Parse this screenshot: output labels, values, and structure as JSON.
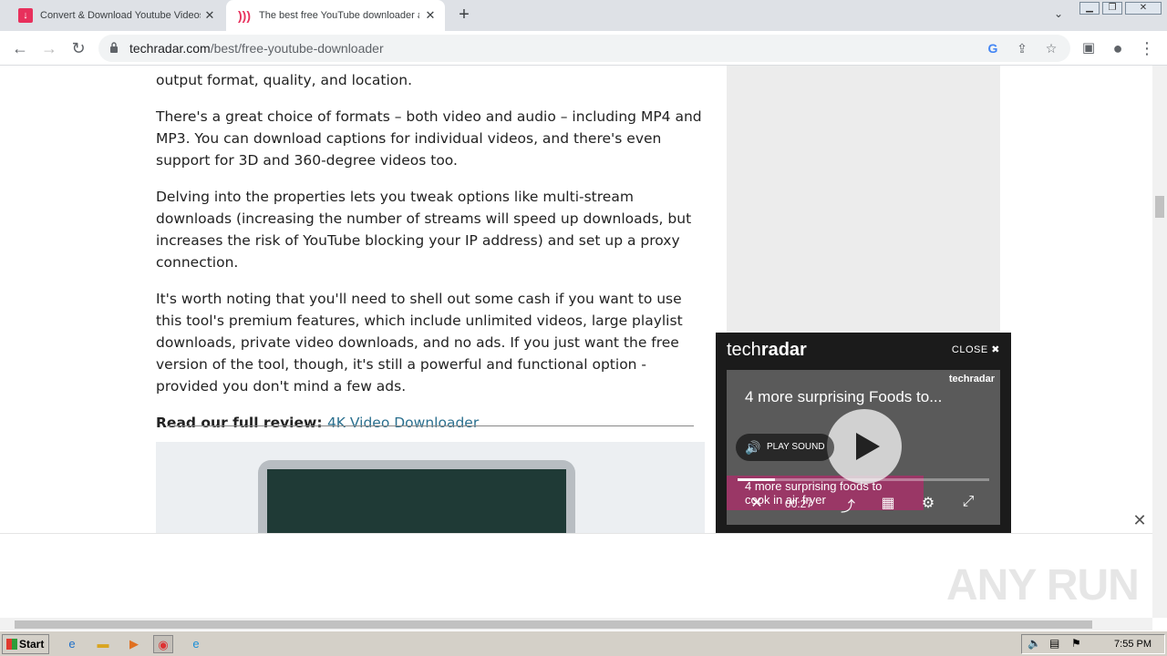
{
  "browser": {
    "tabs": [
      {
        "title": "Convert & Download Youtube Videos",
        "active": false
      },
      {
        "title": "The best free YouTube downloader app",
        "active": true
      }
    ],
    "url_host": "techradar.com",
    "url_path": "/best/free-youtube-downloader"
  },
  "article": {
    "p0": "output format, quality, and location.",
    "p1": "There's a great choice of formats – both video and audio – including MP4 and MP3. You can download captions for individual videos, and there's even support for 3D and 360-degree videos too.",
    "p2": "Delving into the properties lets you tweak options like multi-stream downloads (increasing the number of streams will speed up downloads, but increases the risk of YouTube blocking your IP address) and set up a proxy connection.",
    "p3": "It's worth noting that you'll need to shell out some cash if you want to use this tool's premium features, which include unlimited videos, large playlist downloads, private video downloads, and no ads. If you just want the free version of the tool, though, it's still a powerful and functional option - provided you don't mind a few ads.",
    "read_label": "Read our full review:",
    "read_link": "4K Video Downloader"
  },
  "video": {
    "logo_light": "tech",
    "logo_bold": "radar",
    "close_label": "CLOSE",
    "title": "4 more surprising Foods to...",
    "brand": "techradar",
    "play_sound": "PLAY SOUND",
    "time": "00:27",
    "overlay_text": "4 more surprising foods to cook in air fryer",
    "progress": 0.15
  },
  "watermark": "ANY RUN",
  "taskbar": {
    "start_label": "Start",
    "clock": "7:55 PM"
  }
}
